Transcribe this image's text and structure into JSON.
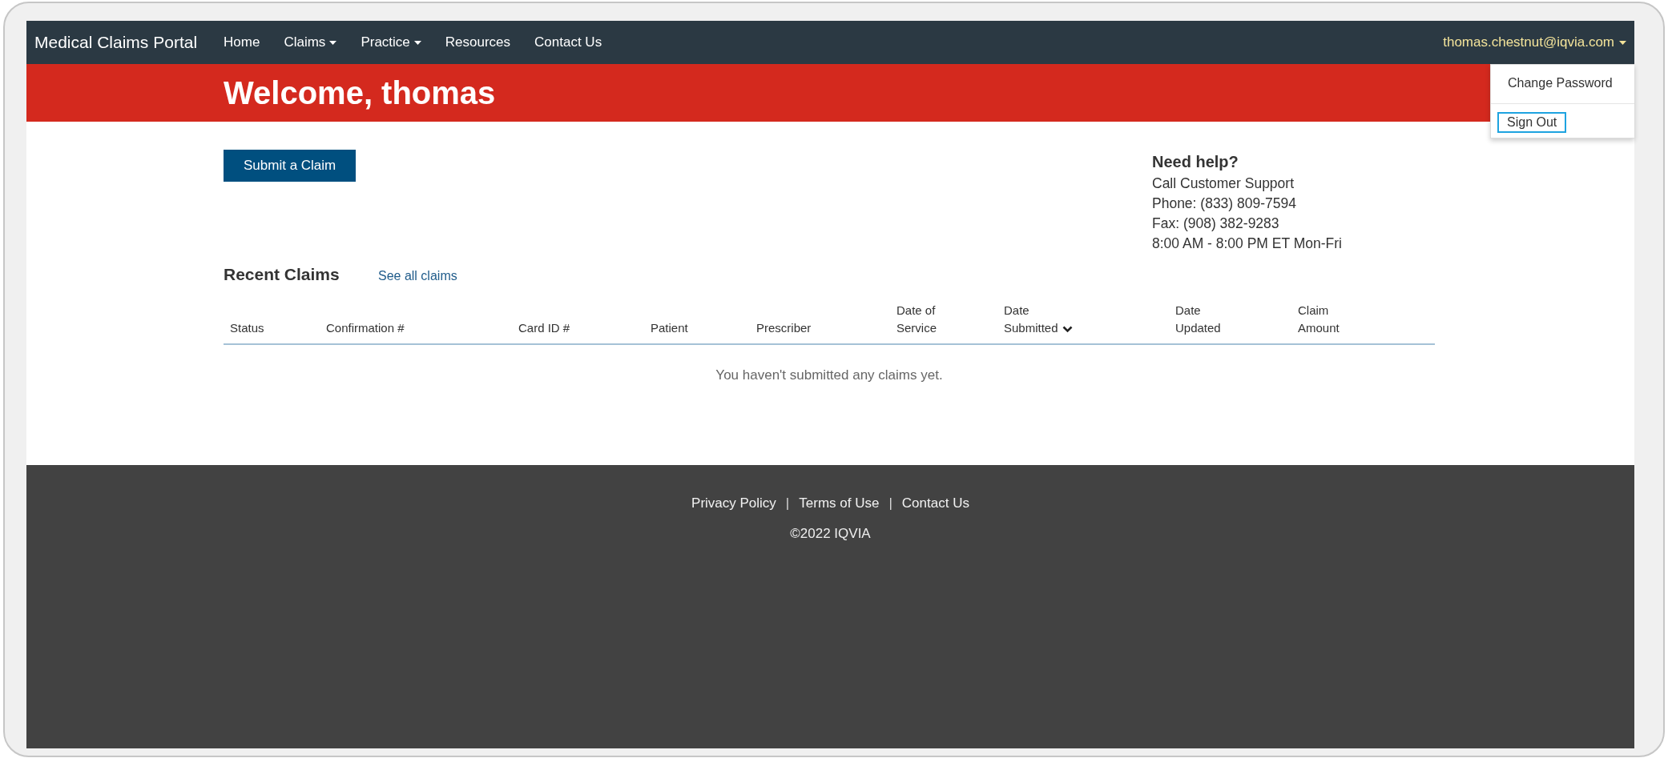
{
  "navbar": {
    "brand": "Medical Claims Portal",
    "items": [
      {
        "label": "Home",
        "dropdown": false
      },
      {
        "label": "Claims",
        "dropdown": true
      },
      {
        "label": "Practice",
        "dropdown": true
      },
      {
        "label": "Resources",
        "dropdown": false
      },
      {
        "label": "Contact Us",
        "dropdown": false
      }
    ],
    "user": {
      "label": "thomas.chestnut@iqvia.com"
    }
  },
  "user_menu": [
    {
      "label": "Change Password",
      "focused": false
    },
    {
      "label": "Sign Out",
      "focused": true
    }
  ],
  "banner": {
    "title": "Welcome, thomas"
  },
  "submit_button": "Submit a Claim",
  "help": {
    "title": "Need help?",
    "lines": [
      "Call Customer Support",
      "Phone: (833) 809-7594",
      "Fax: (908) 382-9283",
      "8:00 AM - 8:00 PM ET Mon-Fri"
    ]
  },
  "recent_claims": {
    "title": "Recent Claims",
    "link": "See all claims",
    "columns": [
      {
        "label": "Status",
        "sorted": false
      },
      {
        "label": "Confirmation #",
        "sorted": false
      },
      {
        "label": "Card ID #",
        "sorted": false
      },
      {
        "label": "Patient",
        "sorted": false
      },
      {
        "label": "Prescriber",
        "sorted": false
      },
      {
        "label": "Date of\nService",
        "sorted": false
      },
      {
        "label": "Date\nSubmitted",
        "sorted": true
      },
      {
        "label": "Date\nUpdated",
        "sorted": false
      },
      {
        "label": "Claim\nAmount",
        "sorted": false
      }
    ],
    "empty_message": "You haven't submitted any claims yet."
  },
  "footer": {
    "items": [
      {
        "kind": "link",
        "text": "Privacy Policy"
      },
      {
        "kind": "separator",
        "text": "|"
      },
      {
        "kind": "link",
        "text": "Terms of Use"
      },
      {
        "kind": "separator",
        "text": "|"
      },
      {
        "kind": "link",
        "text": "Contact Us"
      }
    ],
    "copyright": "©2022 IQVIA"
  }
}
